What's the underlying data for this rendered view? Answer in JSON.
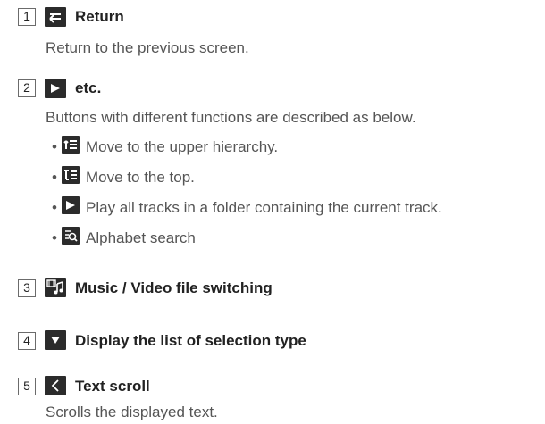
{
  "items": [
    {
      "number": "1",
      "icon": "return-icon",
      "title": "Return",
      "description": "Return to the previous screen."
    },
    {
      "number": "2",
      "icon": "play-icon",
      "title": "etc.",
      "description": "Buttons with different functions are described as below.",
      "bullets": [
        {
          "icon": "upper-hierarchy-icon",
          "text": "Move to the upper hierarchy."
        },
        {
          "icon": "top-icon",
          "text": "Move to the top."
        },
        {
          "icon": "play-icon",
          "text": "Play all tracks in a folder containing the current track."
        },
        {
          "icon": "alphabet-search-icon",
          "text": "Alphabet search"
        }
      ]
    },
    {
      "number": "3",
      "icon": "music-video-switch-icon",
      "title": "Music / Video file switching"
    },
    {
      "number": "4",
      "icon": "triangle-down-icon",
      "title": "Display the list of selection type"
    },
    {
      "number": "5",
      "icon": "chevron-left-icon",
      "title": "Text scroll",
      "description": "Scrolls the displayed text."
    }
  ],
  "colors": {
    "icon_bg": "#2b2b2b",
    "text": "#555555",
    "heading": "#222222"
  }
}
